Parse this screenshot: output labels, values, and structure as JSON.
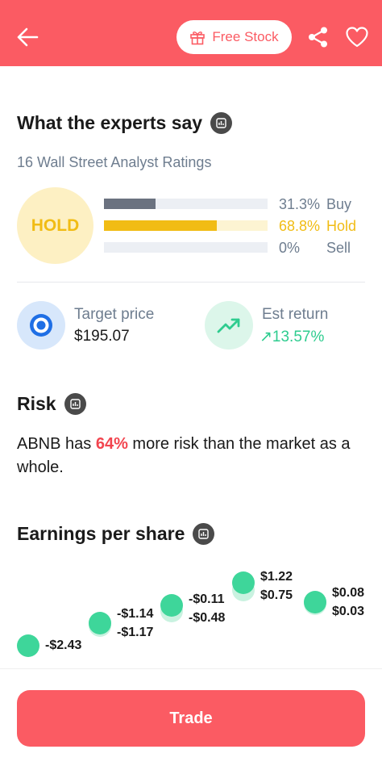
{
  "header": {
    "back_icon": "back-arrow-icon",
    "free_stock_label": "Free Stock",
    "gift_icon": "gift-icon",
    "share_icon": "share-icon",
    "heart_icon": "heart-icon",
    "background_color": "#fb5b63"
  },
  "experts": {
    "title": "What the experts say",
    "subtitle": "16 Wall Street Analyst Ratings",
    "consensus": "HOLD",
    "ratings": [
      {
        "label": "Buy",
        "pct_text": "31.3%",
        "fraction": 0.313,
        "color": "#6b7280",
        "text_color": "#6e7d8f",
        "track": "#eceff4"
      },
      {
        "label": "Hold",
        "pct_text": "68.8%",
        "fraction": 0.688,
        "color": "#f1bc14",
        "text_color": "#f1bc14",
        "track": "#fdf4d2"
      },
      {
        "label": "Sell",
        "pct_text": "0%",
        "fraction": 0.0,
        "color": "#6b7280",
        "text_color": "#6e7d8f",
        "track": "#eceff4"
      }
    ]
  },
  "target": {
    "label": "Target price",
    "value": "$195.07",
    "icon": "target-icon"
  },
  "est_return": {
    "label": "Est return",
    "value": "↗13.57%",
    "icon": "trending-up-icon",
    "color": "#2ecc8f"
  },
  "risk": {
    "title": "Risk",
    "prefix": "ABNB has ",
    "pct": "64%",
    "suffix": " more risk than the market as a whole."
  },
  "eps": {
    "title": "Earnings per share",
    "points": [
      {
        "actual": "-$2.43"
      },
      {
        "actual": "-$1.14",
        "estimate": "-$1.17"
      },
      {
        "actual": "-$0.11",
        "estimate": "-$0.48"
      },
      {
        "actual": "$1.22",
        "estimate": "$0.75"
      },
      {
        "actual": "$0.08",
        "estimate": "$0.03"
      }
    ]
  },
  "trade": {
    "label": "Trade"
  }
}
